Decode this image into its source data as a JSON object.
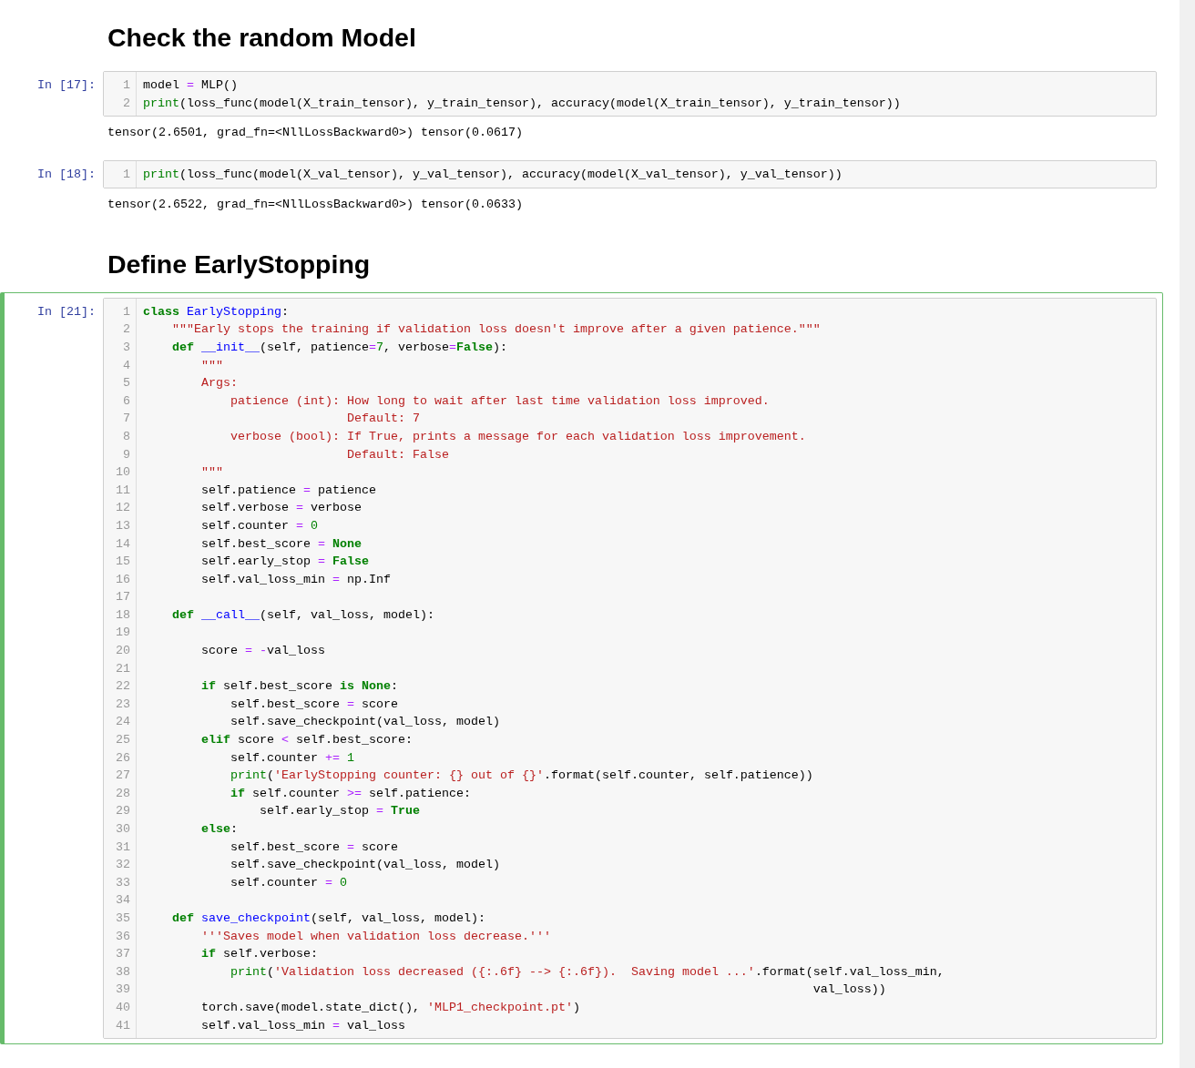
{
  "cells": [
    {
      "kind": "markdown",
      "selected": false,
      "text": "Check the random Model"
    },
    {
      "kind": "code",
      "selected": false,
      "prompt": "In [17]:",
      "lines": [
        {
          "number": "1",
          "tokens": [
            {
              "kind": "p",
              "text": "model "
            },
            {
              "kind": "op",
              "text": "="
            },
            {
              "kind": "p",
              "text": " MLP()"
            }
          ]
        },
        {
          "number": "2",
          "tokens": [
            {
              "kind": "bi",
              "text": "print"
            },
            {
              "kind": "p",
              "text": "(loss_func(model(X_train_tensor), y_train_tensor), accuracy(model(X_train_tensor), y_train_tensor))"
            }
          ]
        }
      ],
      "output": "tensor(2.6501, grad_fn=<NllLossBackward0>) tensor(0.0617)"
    },
    {
      "kind": "code",
      "selected": false,
      "prompt": "In [18]:",
      "lines": [
        {
          "number": "1",
          "tokens": [
            {
              "kind": "bi",
              "text": "print"
            },
            {
              "kind": "p",
              "text": "(loss_func(model(X_val_tensor), y_val_tensor), accuracy(model(X_val_tensor), y_val_tensor))"
            }
          ]
        }
      ],
      "output": "tensor(2.6522, grad_fn=<NllLossBackward0>) tensor(0.0633)"
    },
    {
      "kind": "markdown",
      "selected": false,
      "text": "Define EarlyStopping"
    },
    {
      "kind": "code",
      "selected": true,
      "prompt": "In [21]:",
      "lines": [
        {
          "number": "1",
          "tokens": [
            {
              "kind": "kw",
              "text": "class "
            },
            {
              "kind": "def",
              "text": "EarlyStopping"
            },
            {
              "kind": "p",
              "text": ":"
            }
          ]
        },
        {
          "number": "2",
          "tokens": [
            {
              "kind": "str",
              "text": "    \"\"\"Early stops the training if validation loss doesn't improve after a given patience.\"\"\""
            }
          ]
        },
        {
          "number": "3",
          "tokens": [
            {
              "kind": "kw",
              "text": "    def "
            },
            {
              "kind": "def",
              "text": "__init__"
            },
            {
              "kind": "p",
              "text": "(self, patience"
            },
            {
              "kind": "op",
              "text": "="
            },
            {
              "kind": "num",
              "text": "7"
            },
            {
              "kind": "p",
              "text": ", verbose"
            },
            {
              "kind": "op",
              "text": "="
            },
            {
              "kind": "kw",
              "text": "False"
            },
            {
              "kind": "p",
              "text": "):"
            }
          ]
        },
        {
          "number": "4",
          "tokens": [
            {
              "kind": "str",
              "text": "        \"\"\""
            }
          ]
        },
        {
          "number": "5",
          "tokens": [
            {
              "kind": "str",
              "text": "        Args:"
            }
          ]
        },
        {
          "number": "6",
          "tokens": [
            {
              "kind": "str",
              "text": "            patience (int): How long to wait after last time validation loss improved."
            }
          ]
        },
        {
          "number": "7",
          "tokens": [
            {
              "kind": "str",
              "text": "                            Default: 7"
            }
          ]
        },
        {
          "number": "8",
          "tokens": [
            {
              "kind": "str",
              "text": "            verbose (bool): If True, prints a message for each validation loss improvement."
            }
          ]
        },
        {
          "number": "9",
          "tokens": [
            {
              "kind": "str",
              "text": "                            Default: False"
            }
          ]
        },
        {
          "number": "10",
          "tokens": [
            {
              "kind": "str",
              "text": "        \"\"\""
            }
          ]
        },
        {
          "number": "11",
          "tokens": [
            {
              "kind": "p",
              "text": "        self.patience "
            },
            {
              "kind": "op",
              "text": "="
            },
            {
              "kind": "p",
              "text": " patience"
            }
          ]
        },
        {
          "number": "12",
          "tokens": [
            {
              "kind": "p",
              "text": "        self.verbose "
            },
            {
              "kind": "op",
              "text": "="
            },
            {
              "kind": "p",
              "text": " verbose"
            }
          ]
        },
        {
          "number": "13",
          "tokens": [
            {
              "kind": "p",
              "text": "        self.counter "
            },
            {
              "kind": "op",
              "text": "= "
            },
            {
              "kind": "num",
              "text": "0"
            }
          ]
        },
        {
          "number": "14",
          "tokens": [
            {
              "kind": "p",
              "text": "        self.best_score "
            },
            {
              "kind": "op",
              "text": "= "
            },
            {
              "kind": "kw",
              "text": "None"
            }
          ]
        },
        {
          "number": "15",
          "tokens": [
            {
              "kind": "p",
              "text": "        self.early_stop "
            },
            {
              "kind": "op",
              "text": "= "
            },
            {
              "kind": "kw",
              "text": "False"
            }
          ]
        },
        {
          "number": "16",
          "tokens": [
            {
              "kind": "p",
              "text": "        self.val_loss_min "
            },
            {
              "kind": "op",
              "text": "="
            },
            {
              "kind": "p",
              "text": " np.Inf"
            }
          ]
        },
        {
          "number": "17"
        },
        {
          "number": "18",
          "tokens": [
            {
              "kind": "kw",
              "text": "    def "
            },
            {
              "kind": "def",
              "text": "__call__"
            },
            {
              "kind": "p",
              "text": "(self, val_loss, model):"
            }
          ]
        },
        {
          "number": "19"
        },
        {
          "number": "20",
          "tokens": [
            {
              "kind": "p",
              "text": "        score "
            },
            {
              "kind": "op",
              "text": "= -"
            },
            {
              "kind": "p",
              "text": "val_loss"
            }
          ]
        },
        {
          "number": "21"
        },
        {
          "number": "22",
          "tokens": [
            {
              "kind": "kw",
              "text": "        if"
            },
            {
              "kind": "p",
              "text": " self.best_score "
            },
            {
              "kind": "kw",
              "text": "is None"
            },
            {
              "kind": "p",
              "text": ":"
            }
          ]
        },
        {
          "number": "23",
          "tokens": [
            {
              "kind": "p",
              "text": "            self.best_score "
            },
            {
              "kind": "op",
              "text": "="
            },
            {
              "kind": "p",
              "text": " score"
            }
          ]
        },
        {
          "number": "24",
          "tokens": [
            {
              "kind": "p",
              "text": "            self.save_checkpoint(val_loss, model)"
            }
          ]
        },
        {
          "number": "25",
          "tokens": [
            {
              "kind": "kw",
              "text": "        elif"
            },
            {
              "kind": "p",
              "text": " score "
            },
            {
              "kind": "op",
              "text": "<"
            },
            {
              "kind": "p",
              "text": " self.best_score:"
            }
          ]
        },
        {
          "number": "26",
          "tokens": [
            {
              "kind": "p",
              "text": "            self.counter "
            },
            {
              "kind": "op",
              "text": "+= "
            },
            {
              "kind": "num",
              "text": "1"
            }
          ]
        },
        {
          "number": "27",
          "tokens": [
            {
              "kind": "bi",
              "text": "            print"
            },
            {
              "kind": "p",
              "text": "("
            },
            {
              "kind": "str",
              "text": "'EarlyStopping counter: {} out of {}'"
            },
            {
              "kind": "p",
              "text": ".format(self.counter, self.patience))"
            }
          ]
        },
        {
          "number": "28",
          "tokens": [
            {
              "kind": "kw",
              "text": "            if"
            },
            {
              "kind": "p",
              "text": " self.counter "
            },
            {
              "kind": "op",
              "text": ">="
            },
            {
              "kind": "p",
              "text": " self.patience:"
            }
          ]
        },
        {
          "number": "29",
          "tokens": [
            {
              "kind": "p",
              "text": "                self.early_stop "
            },
            {
              "kind": "op",
              "text": "= "
            },
            {
              "kind": "kw",
              "text": "True"
            }
          ]
        },
        {
          "number": "30",
          "tokens": [
            {
              "kind": "kw",
              "text": "        else"
            },
            {
              "kind": "p",
              "text": ":"
            }
          ]
        },
        {
          "number": "31",
          "tokens": [
            {
              "kind": "p",
              "text": "            self.best_score "
            },
            {
              "kind": "op",
              "text": "="
            },
            {
              "kind": "p",
              "text": " score"
            }
          ]
        },
        {
          "number": "32",
          "tokens": [
            {
              "kind": "p",
              "text": "            self.save_checkpoint(val_loss, model)"
            }
          ]
        },
        {
          "number": "33",
          "tokens": [
            {
              "kind": "p",
              "text": "            self.counter "
            },
            {
              "kind": "op",
              "text": "= "
            },
            {
              "kind": "num",
              "text": "0"
            }
          ]
        },
        {
          "number": "34"
        },
        {
          "number": "35",
          "tokens": [
            {
              "kind": "kw",
              "text": "    def "
            },
            {
              "kind": "def",
              "text": "save_checkpoint"
            },
            {
              "kind": "p",
              "text": "(self, val_loss, model):"
            }
          ]
        },
        {
          "number": "36",
          "tokens": [
            {
              "kind": "str",
              "text": "        '''Saves model when validation loss decrease.'''"
            }
          ]
        },
        {
          "number": "37",
          "tokens": [
            {
              "kind": "kw",
              "text": "        if"
            },
            {
              "kind": "p",
              "text": " self.verbose:"
            }
          ]
        },
        {
          "number": "38",
          "tokens": [
            {
              "kind": "bi",
              "text": "            print"
            },
            {
              "kind": "p",
              "text": "("
            },
            {
              "kind": "str",
              "text": "'Validation loss decreased ({:.6f} --> {:.6f}).  Saving model ...'"
            },
            {
              "kind": "p",
              "text": ".format(self.val_loss_min,"
            }
          ]
        },
        {
          "number": "39",
          "tokens": [
            {
              "kind": "p",
              "text": "                                                                                            val_loss))"
            }
          ]
        },
        {
          "number": "40",
          "tokens": [
            {
              "kind": "p",
              "text": "        torch.save(model.state_dict(), "
            },
            {
              "kind": "str",
              "text": "'MLP1_checkpoint.pt'"
            },
            {
              "kind": "p",
              "text": ")"
            }
          ]
        },
        {
          "number": "41",
          "tokens": [
            {
              "kind": "p",
              "text": "        self.val_loss_min "
            },
            {
              "kind": "op",
              "text": "="
            },
            {
              "kind": "p",
              "text": " val_loss"
            }
          ]
        }
      ]
    }
  ]
}
